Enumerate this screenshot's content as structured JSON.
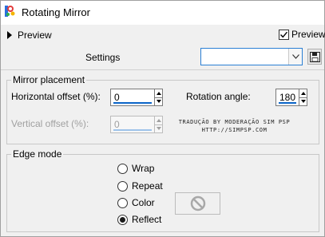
{
  "window": {
    "title": "Rotating Mirror"
  },
  "preview": {
    "toggle_label": "Preview",
    "checkbox_label": "Preview",
    "checked": true
  },
  "settings": {
    "label": "Settings",
    "selected_value": ""
  },
  "mirror_placement": {
    "legend": "Mirror placement",
    "horizontal_offset": {
      "label": "Horizontal offset (%):",
      "value": "0"
    },
    "vertical_offset": {
      "label": "Vertical offset (%):",
      "value": "0",
      "disabled": true
    },
    "rotation_angle": {
      "label": "Rotation angle:",
      "value": "180"
    }
  },
  "watermark": {
    "line1": "TRADUÇÃO BY MODERAÇÃO SIM PSP",
    "line2": "HTTP://SIMPSP.COM"
  },
  "edge_mode": {
    "legend": "Edge mode",
    "options": [
      "Wrap",
      "Repeat",
      "Color",
      "Reflect"
    ],
    "selected": "Reflect"
  },
  "icons": [
    "app-icon",
    "expand-triangle-icon",
    "check-icon",
    "chevron-down-icon",
    "save-icon",
    "spin-up-icon",
    "spin-down-icon",
    "no-color-icon"
  ],
  "colors": {
    "accent": "#0a64c8",
    "focus_border": "#2a7fd4",
    "panel_bg": "#f0f0f0"
  }
}
